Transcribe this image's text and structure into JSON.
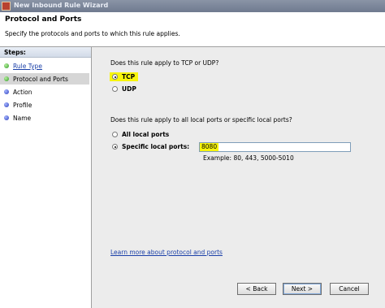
{
  "window": {
    "title": "New Inbound Rule Wizard"
  },
  "header": {
    "title": "Protocol and Ports",
    "subtitle": "Specify the protocols and ports to which this rule applies."
  },
  "sidebar": {
    "heading": "Steps:",
    "items": [
      {
        "label": "Rule Type",
        "status": "complete"
      },
      {
        "label": "Protocol and Ports",
        "status": "current"
      },
      {
        "label": "Action",
        "status": "pending"
      },
      {
        "label": "Profile",
        "status": "pending"
      },
      {
        "label": "Name",
        "status": "pending"
      }
    ]
  },
  "protocol": {
    "question": "Does this rule apply to TCP or UDP?",
    "options": [
      {
        "label": "TCP",
        "selected": true
      },
      {
        "label": "UDP",
        "selected": false
      }
    ]
  },
  "ports": {
    "question": "Does this rule apply to all local ports or specific local ports?",
    "all_label": "All local ports",
    "specific_label": "Specific local ports:",
    "specific_selected": true,
    "value": "8080",
    "example": "Example: 80, 443, 5000-5010"
  },
  "learn_more": "Learn more about protocol and ports",
  "buttons": {
    "back": "< Back",
    "next": "Next >",
    "cancel": "Cancel"
  },
  "colors": {
    "highlight": "#f7f50c",
    "link": "#1a3fa8"
  }
}
